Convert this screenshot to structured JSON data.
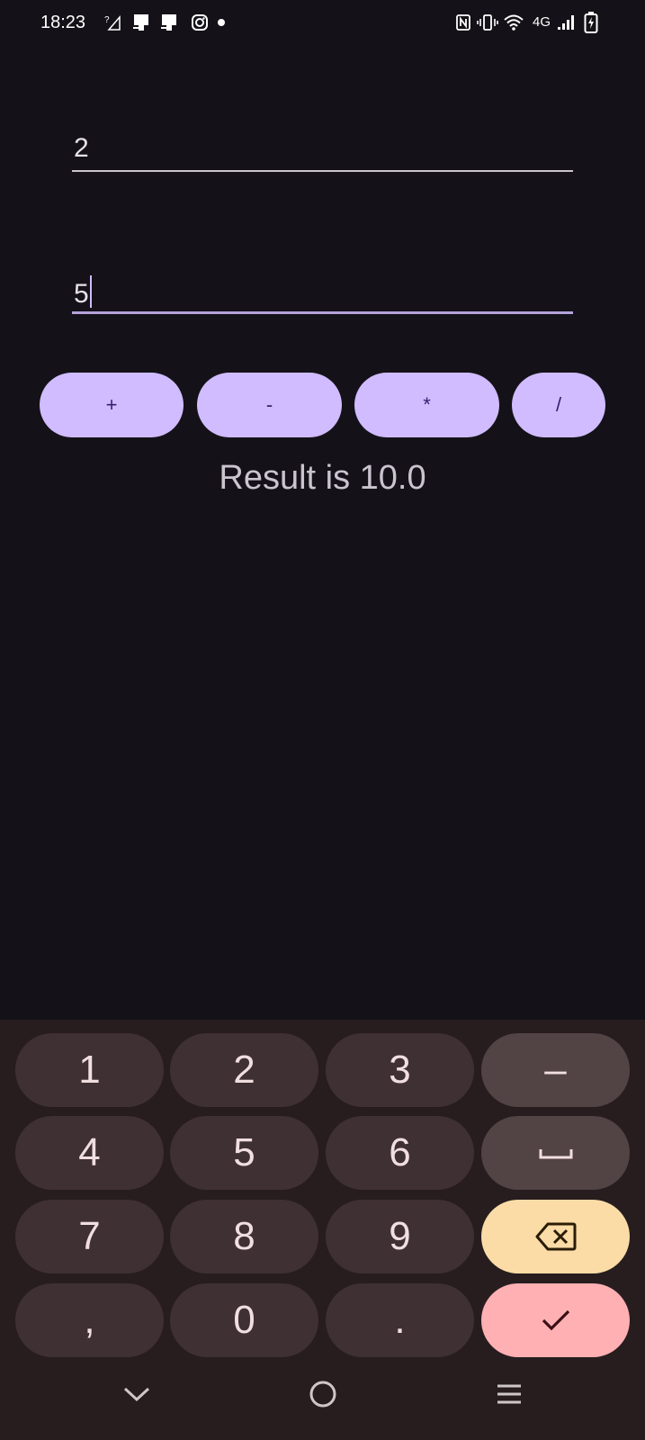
{
  "status_bar": {
    "time": "18:23",
    "network": "4G"
  },
  "inputs": {
    "first_value": "2",
    "second_value": "5"
  },
  "operators": {
    "plus": "+",
    "minus": "-",
    "multiply": "*",
    "divide": "/"
  },
  "result_text": "Result is 10.0",
  "keyboard": {
    "rows": [
      [
        "1",
        "2",
        "3",
        "–"
      ],
      [
        "4",
        "5",
        "6",
        "space"
      ],
      [
        "7",
        "8",
        "9",
        "backspace"
      ],
      [
        ",",
        "0",
        ".",
        "done"
      ]
    ],
    "labels": {
      "k1": "1",
      "k2": "2",
      "k3": "3",
      "dash": "–",
      "k4": "4",
      "k5": "5",
      "k6": "6",
      "k7": "7",
      "k8": "8",
      "k9": "9",
      "comma": ",",
      "k0": "0",
      "dot": "."
    },
    "colors": {
      "background": "#271d1f",
      "digit_key": "#3f3033",
      "side_key": "#524345",
      "backspace_key": "#fcdca6",
      "done_key": "#ffb0b3"
    }
  },
  "colors": {
    "background": "#141218",
    "accent": "#d0bcff",
    "on_accent": "#381e72"
  },
  "icons": [
    "question-signal-icon",
    "sim-card-icon",
    "instagram-icon",
    "nfc-icon",
    "vibrate-icon",
    "wifi-icon",
    "signal-icon",
    "battery-charging-icon",
    "backspace-icon",
    "check-icon",
    "space-icon",
    "nav-back-icon",
    "nav-home-icon",
    "nav-recents-icon"
  ]
}
